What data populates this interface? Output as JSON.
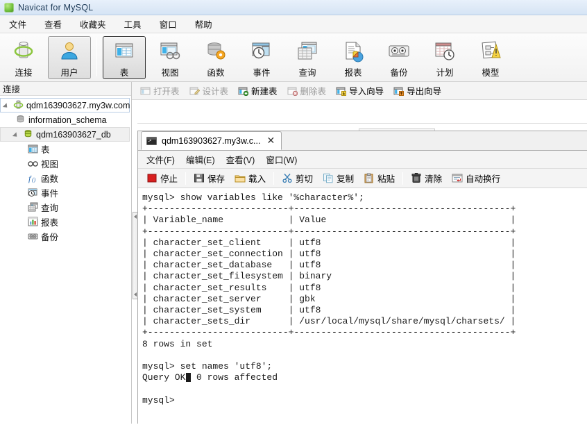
{
  "window": {
    "title": "Navicat for MySQL",
    "icon": "navicat-logo-icon"
  },
  "menubar": {
    "items": [
      {
        "label": "文件",
        "name": "menu-file"
      },
      {
        "label": "查看",
        "name": "menu-view"
      },
      {
        "label": "收藏夹",
        "name": "menu-favorites"
      },
      {
        "label": "工具",
        "name": "menu-tools"
      },
      {
        "label": "窗口",
        "name": "menu-window"
      },
      {
        "label": "帮助",
        "name": "menu-help"
      }
    ]
  },
  "toolbar": {
    "buttons": [
      {
        "label": "连接",
        "icon": "connection-icon",
        "selected": false
      },
      {
        "label": "用户",
        "icon": "user-icon",
        "selected": true
      },
      {
        "label": "表",
        "icon": "table-icon",
        "selected": true
      },
      {
        "label": "视图",
        "icon": "view-icon",
        "selected": false
      },
      {
        "label": "函数",
        "icon": "function-icon",
        "selected": false
      },
      {
        "label": "事件",
        "icon": "event-icon",
        "selected": false
      },
      {
        "label": "查询",
        "icon": "query-icon",
        "selected": false
      },
      {
        "label": "报表",
        "icon": "report-icon",
        "selected": false
      },
      {
        "label": "备份",
        "icon": "backup-icon",
        "selected": false
      },
      {
        "label": "计划",
        "icon": "schedule-icon",
        "selected": false
      },
      {
        "label": "模型",
        "icon": "model-icon",
        "selected": false
      }
    ]
  },
  "subtoolbar": {
    "buttons": [
      {
        "label": "打开表",
        "icon": "open-table-icon",
        "enabled": false
      },
      {
        "label": "设计表",
        "icon": "design-table-icon",
        "enabled": false
      },
      {
        "label": "新建表",
        "icon": "new-table-icon",
        "enabled": true
      },
      {
        "label": "删除表",
        "icon": "delete-table-icon",
        "enabled": false
      },
      {
        "label": "导入向导",
        "icon": "import-wizard-icon",
        "enabled": true
      },
      {
        "label": "导出向导",
        "icon": "export-wizard-icon",
        "enabled": true
      }
    ]
  },
  "sidebar": {
    "header": "连接",
    "tree": [
      {
        "label": "qdm163903627.my3w.com",
        "icon": "server-connection-icon",
        "level": 1,
        "expanded": true,
        "state": "root"
      },
      {
        "label": "information_schema",
        "icon": "database-gray-icon",
        "level": 2,
        "expanded": false,
        "state": "normal"
      },
      {
        "label": "qdm163903627_db",
        "icon": "database-green-icon",
        "level": 2,
        "expanded": true,
        "state": "selected"
      },
      {
        "label": "表",
        "icon": "table-icon",
        "level": 3,
        "expanded": false,
        "state": "normal"
      },
      {
        "label": "视图",
        "icon": "view-glasses-icon",
        "level": 3,
        "expanded": false,
        "state": "normal"
      },
      {
        "label": "函数",
        "icon": "function-fx-icon",
        "level": 3,
        "expanded": false,
        "state": "normal"
      },
      {
        "label": "事件",
        "icon": "event-clock-icon",
        "level": 3,
        "expanded": false,
        "state": "normal"
      },
      {
        "label": "查询",
        "icon": "query-icon",
        "level": 3,
        "expanded": false,
        "state": "normal"
      },
      {
        "label": "报表",
        "icon": "report-chart-icon",
        "level": 3,
        "expanded": false,
        "state": "normal"
      },
      {
        "label": "备份",
        "icon": "backup-tape-icon",
        "level": 3,
        "expanded": false,
        "state": "normal"
      }
    ]
  },
  "console": {
    "tab": {
      "label": "qdm163903627.my3w.c...",
      "icon": "terminal-icon",
      "close": "✕"
    },
    "menubar": [
      {
        "label": "文件(F)",
        "name": "console-menu-file"
      },
      {
        "label": "编辑(E)",
        "name": "console-menu-edit"
      },
      {
        "label": "查看(V)",
        "name": "console-menu-view"
      },
      {
        "label": "窗口(W)",
        "name": "console-menu-window"
      }
    ],
    "toolbar": [
      {
        "label": "停止",
        "icon": "stop-icon",
        "group": 0
      },
      {
        "label": "保存",
        "icon": "save-icon",
        "group": 1
      },
      {
        "label": "载入",
        "icon": "load-folder-icon",
        "group": 1
      },
      {
        "label": "剪切",
        "icon": "cut-scissors-icon",
        "group": 2
      },
      {
        "label": "复制",
        "icon": "copy-icon",
        "group": 2
      },
      {
        "label": "粘贴",
        "icon": "paste-clipboard-icon",
        "group": 2
      },
      {
        "label": "清除",
        "icon": "clear-trash-icon",
        "group": 3
      },
      {
        "label": "自动换行",
        "icon": "word-wrap-icon",
        "group": 3
      }
    ],
    "output": "mysql> show variables like '%character%';\n+--------------------------+----------------------------------------+\n| Variable_name            | Value                                  |\n+--------------------------+----------------------------------------+\n| character_set_client     | utf8                                   |\n| character_set_connection | utf8                                   |\n| character_set_database   | utf8                                   |\n| character_set_filesystem | binary                                 |\n| character_set_results    | utf8                                   |\n| character_set_server     | gbk                                    |\n| character_set_system     | utf8                                   |\n| character_sets_dir       | /usr/local/mysql/share/mysql/charsets/ |\n+--------------------------+----------------------------------------+\n8 rows in set\n\nmysql> set names 'utf8';\nQuery OK, 0 rows affected\n\nmysql> ",
    "prompt_caret": true
  },
  "colors": {
    "accent": "#3c8a1c",
    "title_bg": "#dfeaf7",
    "toolbar_bg": "#f4f4f4",
    "stop_red": "#cc2222",
    "terminal_text": "#1a1a1a"
  }
}
